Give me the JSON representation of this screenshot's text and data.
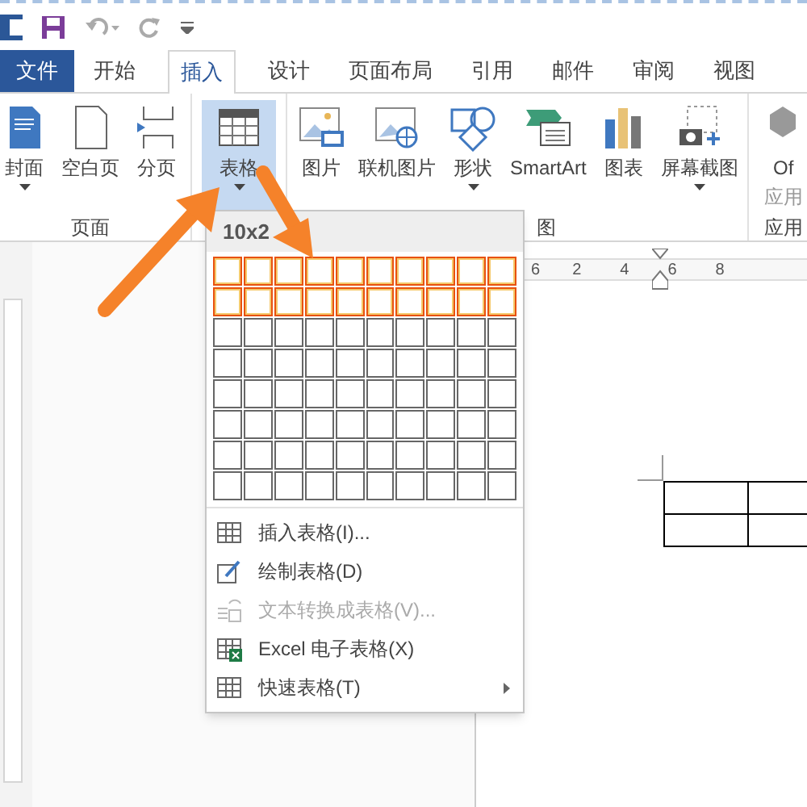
{
  "tabs": [
    {
      "label": "文件",
      "kind": "file",
      "selected": false
    },
    {
      "label": "开始",
      "kind": "tab",
      "selected": false
    },
    {
      "label": "插入",
      "kind": "tab",
      "selected": true
    },
    {
      "label": "设计",
      "kind": "tab",
      "selected": false
    },
    {
      "label": "页面布局",
      "kind": "tab",
      "selected": false
    },
    {
      "label": "引用",
      "kind": "tab",
      "selected": false
    },
    {
      "label": "邮件",
      "kind": "tab",
      "selected": false
    },
    {
      "label": "审阅",
      "kind": "tab",
      "selected": false
    },
    {
      "label": "视图",
      "kind": "tab",
      "selected": false
    }
  ],
  "ribbon": {
    "groups": [
      {
        "label": "页面",
        "buttons": [
          {
            "label": "封面",
            "kind": "cover",
            "dropdown": true,
            "selected": false
          },
          {
            "label": "空白页",
            "kind": "blank",
            "dropdown": false,
            "selected": false
          },
          {
            "label": "分页",
            "kind": "break",
            "dropdown": false,
            "selected": false
          }
        ]
      },
      {
        "buttons": [
          {
            "label": "表格",
            "kind": "table",
            "dropdown": true,
            "selected": true
          }
        ]
      },
      {
        "label": "图",
        "buttons": [
          {
            "label": "图片",
            "kind": "picture",
            "dropdown": false,
            "selected": false
          },
          {
            "label": "联机图片",
            "kind": "online",
            "dropdown": false,
            "selected": false
          },
          {
            "label": "形状",
            "kind": "shapes",
            "dropdown": true,
            "selected": false
          },
          {
            "label": "SmartArt",
            "kind": "smartart",
            "dropdown": false,
            "selected": false
          },
          {
            "label": "图表",
            "kind": "chart",
            "dropdown": false,
            "selected": false
          },
          {
            "label": "屏幕截图",
            "kind": "screenshot",
            "dropdown": true,
            "selected": false
          }
        ]
      },
      {
        "label": "应用",
        "buttons": [
          {
            "label": "Of",
            "label2": "应用",
            "kind": "apps",
            "dropdown": false,
            "selected": false
          }
        ]
      }
    ]
  },
  "ruler": [
    "6",
    "2",
    "4",
    "6",
    "8"
  ],
  "table_menu": {
    "header": "10x2",
    "grid": [
      [
        true,
        true,
        true,
        true,
        true,
        true,
        true,
        true,
        true,
        true
      ],
      [
        true,
        true,
        true,
        true,
        true,
        true,
        true,
        true,
        true,
        true
      ],
      [
        false,
        false,
        false,
        false,
        false,
        false,
        false,
        false,
        false,
        false
      ],
      [
        false,
        false,
        false,
        false,
        false,
        false,
        false,
        false,
        false,
        false
      ],
      [
        false,
        false,
        false,
        false,
        false,
        false,
        false,
        false,
        false,
        false
      ],
      [
        false,
        false,
        false,
        false,
        false,
        false,
        false,
        false,
        false,
        false
      ],
      [
        false,
        false,
        false,
        false,
        false,
        false,
        false,
        false,
        false,
        false
      ],
      [
        false,
        false,
        false,
        false,
        false,
        false,
        false,
        false,
        false,
        false
      ]
    ],
    "items": [
      {
        "label": "插入表格(I)...",
        "kind": "insert",
        "disabled": false,
        "submenu": false
      },
      {
        "label": "绘制表格(D)",
        "kind": "draw",
        "disabled": false,
        "submenu": false
      },
      {
        "label": "文本转换成表格(V)...",
        "kind": "convert",
        "disabled": true,
        "submenu": false
      },
      {
        "label": "Excel 电子表格(X)",
        "kind": "excel",
        "disabled": false,
        "submenu": false
      },
      {
        "label": "快速表格(T)",
        "kind": "quick",
        "disabled": false,
        "submenu": true
      }
    ]
  }
}
